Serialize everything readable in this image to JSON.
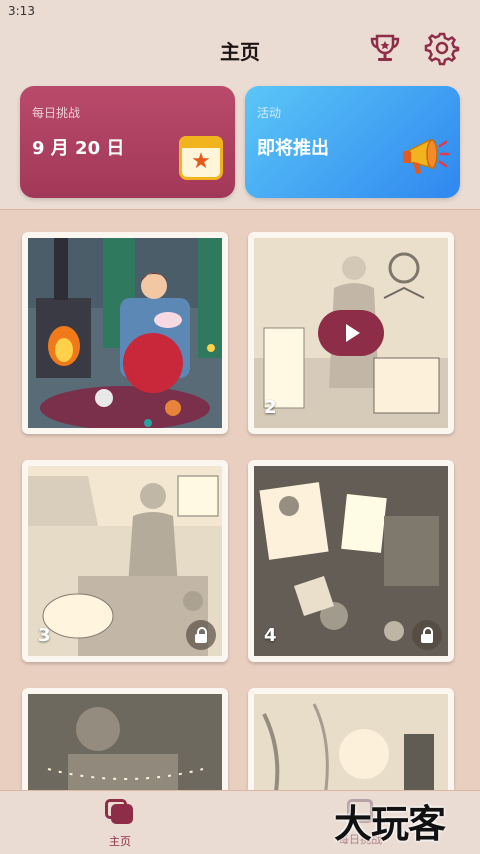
{
  "status_bar": {
    "time": "3:13"
  },
  "header": {
    "title": "主页",
    "trophy_icon": "trophy-icon",
    "settings_icon": "gear-icon"
  },
  "cards": {
    "daily": {
      "label": "每日挑战",
      "date": "9 月 20 日",
      "icon": "calendar-star-icon"
    },
    "event": {
      "label": "活动",
      "status": "即将推出",
      "icon": "megaphone-icon"
    }
  },
  "levels": [
    {
      "number": "",
      "locked": false,
      "has_video": false
    },
    {
      "number": "2",
      "locked": false,
      "has_video": true
    },
    {
      "number": "3",
      "locked": true,
      "has_video": false
    },
    {
      "number": "4",
      "locked": true,
      "has_video": false
    },
    {
      "number": "",
      "locked": true,
      "has_video": false
    },
    {
      "number": "",
      "locked": true,
      "has_video": false
    }
  ],
  "nav": {
    "home_label": "主页",
    "daily_label": "每日挑战"
  },
  "watermark": "大玩客",
  "colors": {
    "accent": "#8e2d47",
    "daily_card": "#a8415f",
    "event_card": "#3a95f0",
    "background": "#e9cfc0"
  }
}
